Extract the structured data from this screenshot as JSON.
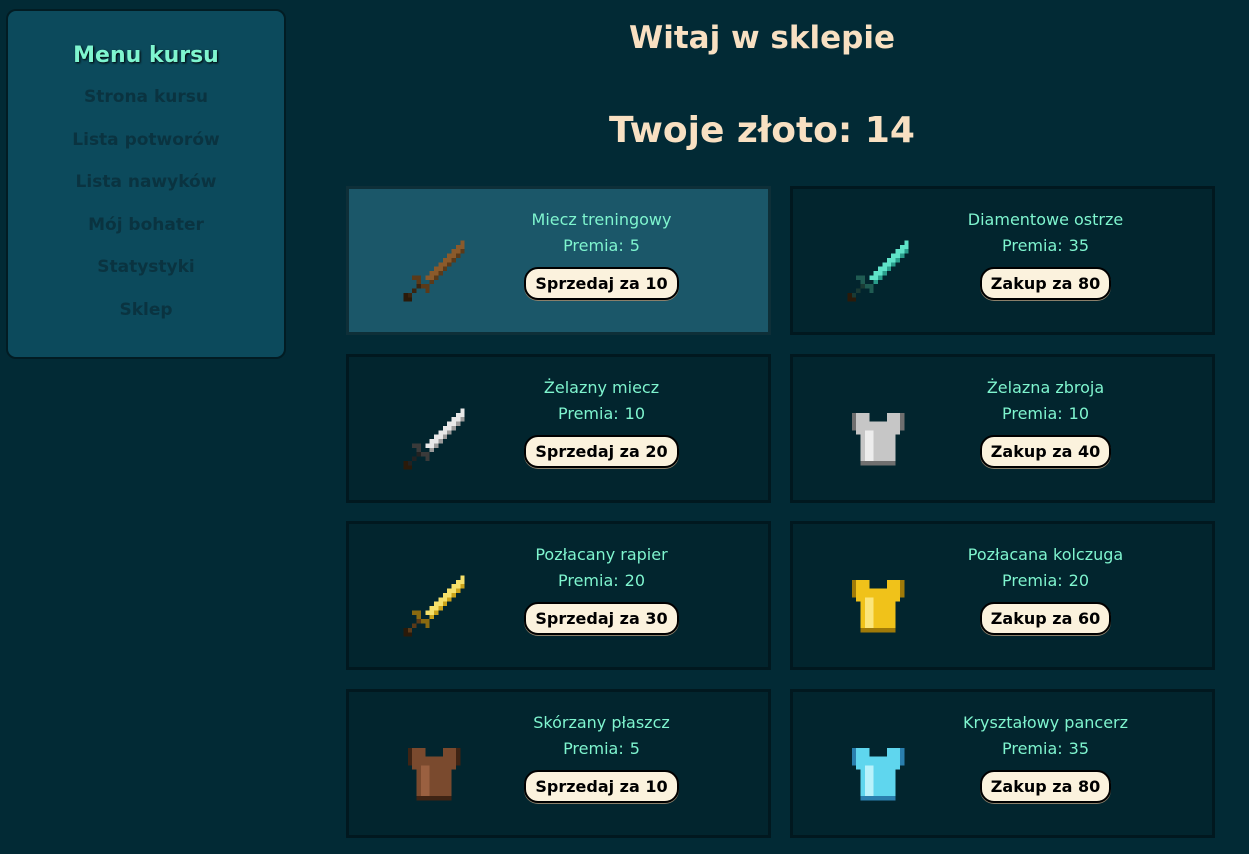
{
  "sidebar": {
    "title": "Menu kursu",
    "items": [
      {
        "label": "Strona kursu"
      },
      {
        "label": "Lista potworów"
      },
      {
        "label": "Lista nawyków"
      },
      {
        "label": "Mój bohater"
      },
      {
        "label": "Statystyki"
      },
      {
        "label": "Sklep"
      }
    ]
  },
  "header": {
    "welcome": "Witaj w sklepie",
    "gold_label": "Twoje złoto:",
    "gold_value": "14"
  },
  "items": [
    {
      "name": "Miecz treningowy",
      "bonus_label": "Premia:",
      "bonus": "5",
      "action": "Sprzedaj za",
      "price": "10",
      "icon": "wooden-sword-icon",
      "owned": true,
      "highlighted": true
    },
    {
      "name": "Diamentowe ostrze",
      "bonus_label": "Premia:",
      "bonus": "35",
      "action": "Zakup za",
      "price": "80",
      "icon": "diamond-sword-icon",
      "owned": false
    },
    {
      "name": "Żelazny miecz",
      "bonus_label": "Premia:",
      "bonus": "10",
      "action": "Sprzedaj za",
      "price": "20",
      "icon": "iron-sword-icon",
      "owned": true
    },
    {
      "name": "Żelazna zbroja",
      "bonus_label": "Premia:",
      "bonus": "10",
      "action": "Zakup za",
      "price": "40",
      "icon": "iron-armor-icon",
      "owned": false
    },
    {
      "name": "Pozłacany rapier",
      "bonus_label": "Premia:",
      "bonus": "20",
      "action": "Sprzedaj za",
      "price": "30",
      "icon": "golden-sword-icon",
      "owned": true
    },
    {
      "name": "Pozłacana kolczuga",
      "bonus_label": "Premia:",
      "bonus": "20",
      "action": "Zakup za",
      "price": "60",
      "icon": "golden-armor-icon",
      "owned": false
    },
    {
      "name": "Skórzany płaszcz",
      "bonus_label": "Premia:",
      "bonus": "5",
      "action": "Sprzedaj za",
      "price": "10",
      "icon": "leather-armor-icon",
      "owned": true
    },
    {
      "name": "Kryształowy pancerz",
      "bonus_label": "Premia:",
      "bonus": "35",
      "action": "Zakup za",
      "price": "80",
      "icon": "crystal-armor-icon",
      "owned": false
    }
  ],
  "colors": {
    "background": "#022a35",
    "accent": "#7ff5cf",
    "heading": "#f8e0c2",
    "button": "#fbf2dd"
  }
}
